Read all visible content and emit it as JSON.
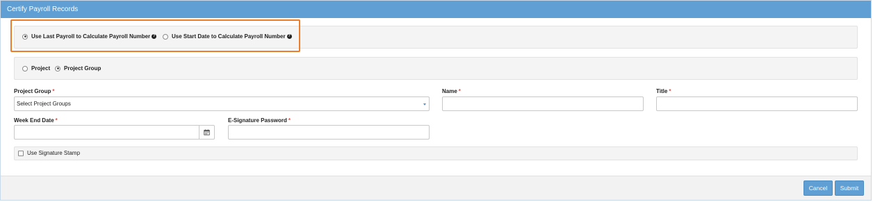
{
  "panel": {
    "title": "Certify Payroll Records"
  },
  "calc_method": {
    "options": [
      {
        "label": "Use Last Payroll to Calculate Payroll Number",
        "selected": true,
        "help_icon": "question-circle-icon"
      },
      {
        "label": "Use Start Date to Calculate Payroll Number",
        "selected": false,
        "help_icon": "question-circle-icon"
      }
    ]
  },
  "scope": {
    "options": [
      {
        "label": "Project",
        "selected": false
      },
      {
        "label": "Project Group",
        "selected": true
      }
    ]
  },
  "fields": {
    "project_group": {
      "label": "Project Group",
      "required_mark": "*",
      "value": "Select Project Groups"
    },
    "name": {
      "label": "Name",
      "required_mark": "*",
      "value": ""
    },
    "title": {
      "label": "Title",
      "required_mark": "*",
      "value": ""
    },
    "week_end_date": {
      "label": "Week End Date",
      "required_mark": "*",
      "value": "",
      "icon": "calendar-icon"
    },
    "esignature_password": {
      "label": "E-Signature Password",
      "required_mark": "*",
      "value": ""
    }
  },
  "signature_stamp": {
    "label": "Use Signature Stamp",
    "checked": false
  },
  "footer": {
    "cancel_label": "Cancel",
    "submit_label": "Submit"
  },
  "colors": {
    "header": "#5f9fd3",
    "highlight": "#ec7d2b",
    "required": "#d9534f",
    "button": "#5f9fd3"
  }
}
